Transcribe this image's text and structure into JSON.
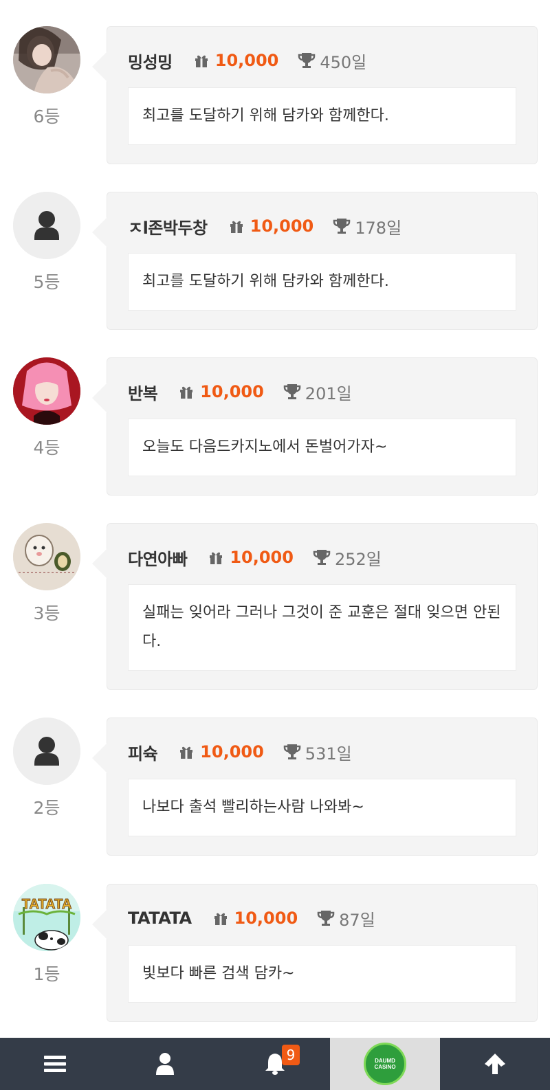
{
  "entries": [
    {
      "rank": "6등",
      "name": "밍성밍",
      "points": "10,000",
      "days": "450일",
      "message": "최고를 도달하기 위해 담카와 함께한다.",
      "avatar": "photo-woman"
    },
    {
      "rank": "5등",
      "name": "ㅈl존박두창",
      "points": "10,000",
      "days": "178일",
      "message": "최고를 도달하기 위해 담카와 함께한다.",
      "avatar": "default-user"
    },
    {
      "rank": "4등",
      "name": "반복",
      "points": "10,000",
      "days": "201일",
      "message": "오늘도 다음드카지노에서 돈벌어가자~",
      "avatar": "photo-pink"
    },
    {
      "rank": "3등",
      "name": "다연아빠",
      "points": "10,000",
      "days": "252일",
      "message": "실패는 잊어라 그러나 그것이 준 교훈은 절대 잊으면 안된다.",
      "avatar": "photo-cartoon"
    },
    {
      "rank": "2등",
      "name": "피슉",
      "points": "10,000",
      "days": "531일",
      "message": "나보다 출석 빨리하는사람 나와봐~",
      "avatar": "default-user"
    },
    {
      "rank": "1등",
      "name": "TATATA",
      "points": "10,000",
      "days": "87일",
      "message": "빛보다 빠른 검색 담카~",
      "avatar": "photo-tatata"
    }
  ],
  "avatar_text": {
    "tatata": "TATATA"
  },
  "tabbar": {
    "items": [
      "menu-icon",
      "user-icon",
      "bell-icon",
      "logo",
      "arrow-up-icon"
    ],
    "notification_count": "9",
    "logo_line1": "DAUMD",
    "logo_line2": "CASINO"
  },
  "colors": {
    "accent": "#f05a14",
    "tabbar_bg": "#343c48",
    "card_bg": "#f4f4f4"
  }
}
